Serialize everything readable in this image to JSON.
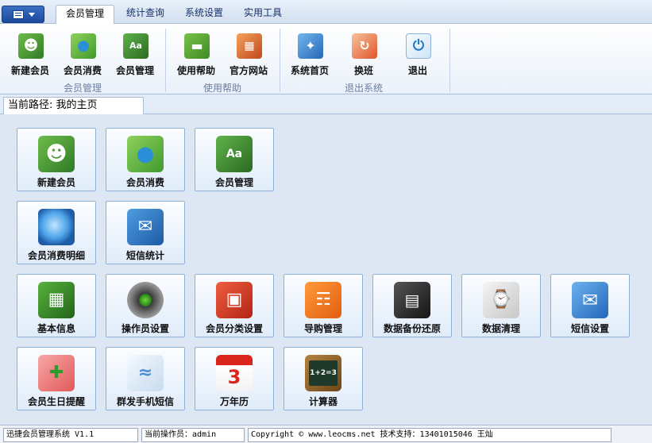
{
  "tabs": [
    "会员管理",
    "统计查询",
    "系统设置",
    "实用工具"
  ],
  "ribbon": {
    "buttons": [
      {
        "label": "新建会员",
        "icon": "member-book-icon"
      },
      {
        "label": "会员消费",
        "icon": "water-drop-icon"
      },
      {
        "label": "会员管理",
        "icon": "aa-book-icon"
      },
      {
        "label": "使用帮助",
        "icon": "chat-bubble-icon"
      },
      {
        "label": "官方网站",
        "icon": "storefront-icon"
      },
      {
        "label": "系统首页",
        "icon": "compass-icon"
      },
      {
        "label": "换班",
        "icon": "swap-icon"
      },
      {
        "label": "退出",
        "icon": "power-icon"
      }
    ],
    "groups": [
      "会员管理",
      "使用帮助",
      "退出系统"
    ]
  },
  "path": {
    "label": "当前路径:",
    "value": "我的主页"
  },
  "tiles": [
    {
      "label": "新建会员",
      "icon": "member-book-icon"
    },
    {
      "label": "会员消费",
      "icon": "water-drop-icon"
    },
    {
      "label": "会员管理",
      "icon": "aa-book-icon"
    },
    {
      "label": "会员消费明细",
      "icon": "magnifier-icon"
    },
    {
      "label": "短信统计",
      "icon": "mail-icon"
    },
    {
      "label": "基本信息",
      "icon": "chip-icon"
    },
    {
      "label": "操作员设置",
      "icon": "gear-icon"
    },
    {
      "label": "会员分类设置",
      "icon": "puzzle-icon"
    },
    {
      "label": "导购管理",
      "icon": "org-chart-icon"
    },
    {
      "label": "数据备份还原",
      "icon": "floppy-disk-icon"
    },
    {
      "label": "数据清理",
      "icon": "shopping-cart-icon"
    },
    {
      "label": "短信设置",
      "icon": "envelope-icon"
    },
    {
      "label": "会员生日提醒",
      "icon": "gift-icon"
    },
    {
      "label": "群发手机短信",
      "icon": "wifi-icon"
    },
    {
      "label": "万年历",
      "icon": "calendar-icon",
      "day": "3"
    },
    {
      "label": "计算器",
      "icon": "calculator-board-icon",
      "formula": "1+2=3"
    }
  ],
  "status": {
    "app": "迅捷会员管理系统 V1.1",
    "operator": "当前操作员：admin",
    "copyright": "Copyright © www.leocms.net 技术支持：13401015046 王灿"
  }
}
